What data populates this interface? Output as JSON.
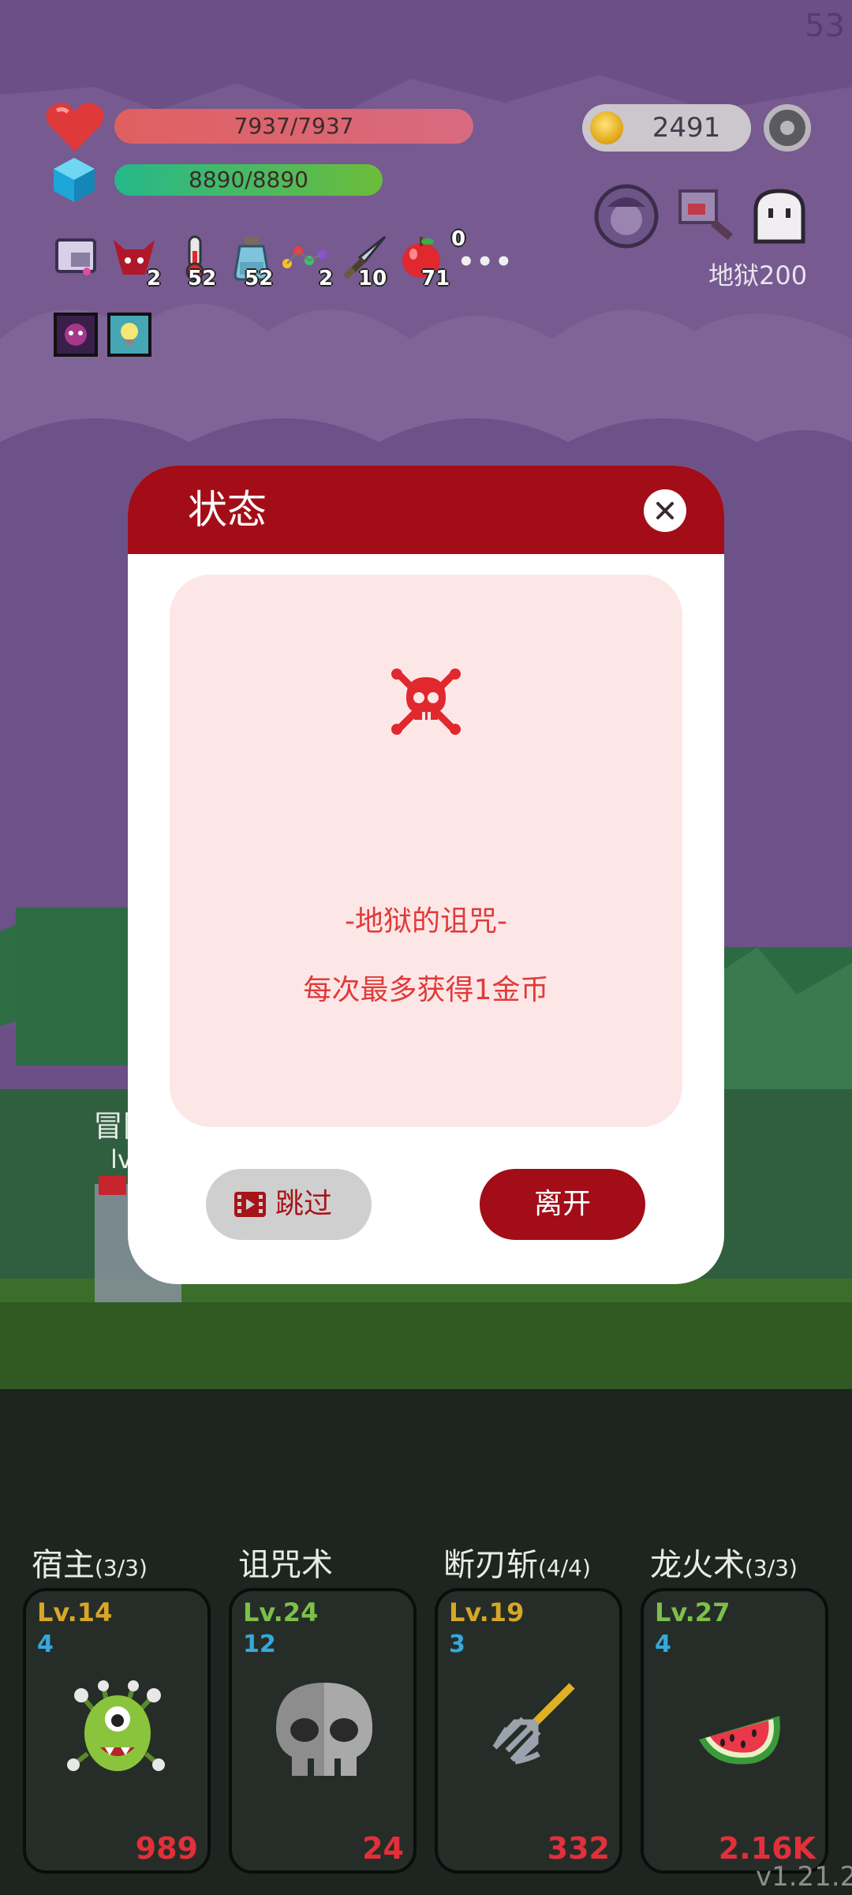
{
  "hud": {
    "fps": "53",
    "hp_text": "7937/7937",
    "mp_text": "8890/8890",
    "gold": "2491",
    "hell_label": "地狱200",
    "inventory": [
      {
        "icon": "scroll-icon",
        "count": ""
      },
      {
        "icon": "demon-helmet-icon",
        "count": "2"
      },
      {
        "icon": "thermometer-potion-icon",
        "count": "52"
      },
      {
        "icon": "potion-jar-icon",
        "count": "52"
      },
      {
        "icon": "gem-chain-icon",
        "count": "2"
      },
      {
        "icon": "dagger-icon",
        "count": "10"
      },
      {
        "icon": "apple-icon",
        "count": "71"
      },
      {
        "icon": "more-icon",
        "count": "0"
      }
    ],
    "buffs": [
      "purple-demon-buff-icon",
      "lightbulb-buff-icon"
    ],
    "top_right_icons": [
      "ghost-girl-icon",
      "cleaver-icon",
      "ghost-icon"
    ]
  },
  "battlefield": {
    "player_name_partial": "冒险",
    "player_level_partial": "lv"
  },
  "modal": {
    "title": "状态",
    "curse_title": "-地狱的诅咒-",
    "curse_desc": "每次最多获得1金币",
    "skip_label": "跳过",
    "leave_label": "离开",
    "colors": {
      "header": "#a30d18",
      "card": "#fde7e6",
      "text": "#e03a3a"
    }
  },
  "skills": [
    {
      "name": "宿主",
      "count": "(3/3)",
      "level": "Lv.14",
      "level_color": "#d6a727",
      "sub": "4",
      "icon": "eyeball-monster-icon",
      "cost": "989"
    },
    {
      "name": "诅咒术",
      "count": "",
      "level": "Lv.24",
      "level_color": "#7cc04a",
      "sub": "12",
      "icon": "skull-icon",
      "cost": "24"
    },
    {
      "name": "断刃斩",
      "count": "(4/4)",
      "level": "Lv.19",
      "level_color": "#d6a727",
      "sub": "3",
      "icon": "pitchfork-icon",
      "cost": "332"
    },
    {
      "name": "龙火术",
      "count": "(3/3)",
      "level": "Lv.27",
      "level_color": "#7cc04a",
      "sub": "4",
      "icon": "watermelon-icon",
      "cost": "2.16K"
    }
  ],
  "version": "v1.21.2"
}
